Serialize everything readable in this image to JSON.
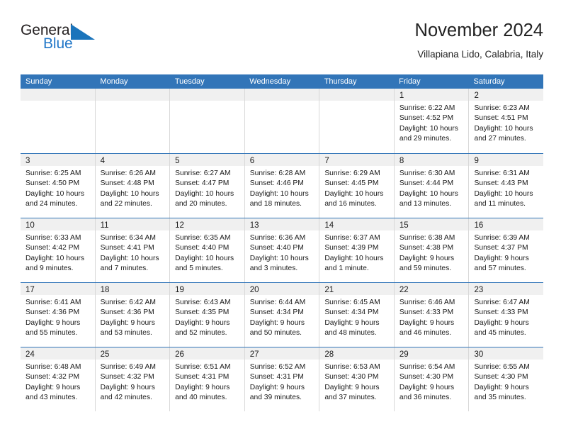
{
  "logo": {
    "word_top": "General",
    "word_bottom": "Blue",
    "triangle_icon": "blue-triangle-icon",
    "top_color": "#231f20",
    "bottom_color": "#2277c8"
  },
  "header": {
    "title": "November 2024",
    "subtitle": "Villapiana Lido, Calabria, Italy"
  },
  "theme": {
    "header_blue": "#3275b8",
    "daynum_strip": "#f0f0f0",
    "cell_border": "#d8d8d8",
    "text": "#1a1a1a"
  },
  "weekdays": [
    "Sunday",
    "Monday",
    "Tuesday",
    "Wednesday",
    "Thursday",
    "Friday",
    "Saturday"
  ],
  "weeks": [
    [
      {
        "day": ""
      },
      {
        "day": ""
      },
      {
        "day": ""
      },
      {
        "day": ""
      },
      {
        "day": ""
      },
      {
        "day": "1",
        "sunrise": "Sunrise: 6:22 AM",
        "sunset": "Sunset: 4:52 PM",
        "daylight_1": "Daylight: 10 hours",
        "daylight_2": "and 29 minutes."
      },
      {
        "day": "2",
        "sunrise": "Sunrise: 6:23 AM",
        "sunset": "Sunset: 4:51 PM",
        "daylight_1": "Daylight: 10 hours",
        "daylight_2": "and 27 minutes."
      }
    ],
    [
      {
        "day": "3",
        "sunrise": "Sunrise: 6:25 AM",
        "sunset": "Sunset: 4:50 PM",
        "daylight_1": "Daylight: 10 hours",
        "daylight_2": "and 24 minutes."
      },
      {
        "day": "4",
        "sunrise": "Sunrise: 6:26 AM",
        "sunset": "Sunset: 4:48 PM",
        "daylight_1": "Daylight: 10 hours",
        "daylight_2": "and 22 minutes."
      },
      {
        "day": "5",
        "sunrise": "Sunrise: 6:27 AM",
        "sunset": "Sunset: 4:47 PM",
        "daylight_1": "Daylight: 10 hours",
        "daylight_2": "and 20 minutes."
      },
      {
        "day": "6",
        "sunrise": "Sunrise: 6:28 AM",
        "sunset": "Sunset: 4:46 PM",
        "daylight_1": "Daylight: 10 hours",
        "daylight_2": "and 18 minutes."
      },
      {
        "day": "7",
        "sunrise": "Sunrise: 6:29 AM",
        "sunset": "Sunset: 4:45 PM",
        "daylight_1": "Daylight: 10 hours",
        "daylight_2": "and 16 minutes."
      },
      {
        "day": "8",
        "sunrise": "Sunrise: 6:30 AM",
        "sunset": "Sunset: 4:44 PM",
        "daylight_1": "Daylight: 10 hours",
        "daylight_2": "and 13 minutes."
      },
      {
        "day": "9",
        "sunrise": "Sunrise: 6:31 AM",
        "sunset": "Sunset: 4:43 PM",
        "daylight_1": "Daylight: 10 hours",
        "daylight_2": "and 11 minutes."
      }
    ],
    [
      {
        "day": "10",
        "sunrise": "Sunrise: 6:33 AM",
        "sunset": "Sunset: 4:42 PM",
        "daylight_1": "Daylight: 10 hours",
        "daylight_2": "and 9 minutes."
      },
      {
        "day": "11",
        "sunrise": "Sunrise: 6:34 AM",
        "sunset": "Sunset: 4:41 PM",
        "daylight_1": "Daylight: 10 hours",
        "daylight_2": "and 7 minutes."
      },
      {
        "day": "12",
        "sunrise": "Sunrise: 6:35 AM",
        "sunset": "Sunset: 4:40 PM",
        "daylight_1": "Daylight: 10 hours",
        "daylight_2": "and 5 minutes."
      },
      {
        "day": "13",
        "sunrise": "Sunrise: 6:36 AM",
        "sunset": "Sunset: 4:40 PM",
        "daylight_1": "Daylight: 10 hours",
        "daylight_2": "and 3 minutes."
      },
      {
        "day": "14",
        "sunrise": "Sunrise: 6:37 AM",
        "sunset": "Sunset: 4:39 PM",
        "daylight_1": "Daylight: 10 hours",
        "daylight_2": "and 1 minute."
      },
      {
        "day": "15",
        "sunrise": "Sunrise: 6:38 AM",
        "sunset": "Sunset: 4:38 PM",
        "daylight_1": "Daylight: 9 hours",
        "daylight_2": "and 59 minutes."
      },
      {
        "day": "16",
        "sunrise": "Sunrise: 6:39 AM",
        "sunset": "Sunset: 4:37 PM",
        "daylight_1": "Daylight: 9 hours",
        "daylight_2": "and 57 minutes."
      }
    ],
    [
      {
        "day": "17",
        "sunrise": "Sunrise: 6:41 AM",
        "sunset": "Sunset: 4:36 PM",
        "daylight_1": "Daylight: 9 hours",
        "daylight_2": "and 55 minutes."
      },
      {
        "day": "18",
        "sunrise": "Sunrise: 6:42 AM",
        "sunset": "Sunset: 4:36 PM",
        "daylight_1": "Daylight: 9 hours",
        "daylight_2": "and 53 minutes."
      },
      {
        "day": "19",
        "sunrise": "Sunrise: 6:43 AM",
        "sunset": "Sunset: 4:35 PM",
        "daylight_1": "Daylight: 9 hours",
        "daylight_2": "and 52 minutes."
      },
      {
        "day": "20",
        "sunrise": "Sunrise: 6:44 AM",
        "sunset": "Sunset: 4:34 PM",
        "daylight_1": "Daylight: 9 hours",
        "daylight_2": "and 50 minutes."
      },
      {
        "day": "21",
        "sunrise": "Sunrise: 6:45 AM",
        "sunset": "Sunset: 4:34 PM",
        "daylight_1": "Daylight: 9 hours",
        "daylight_2": "and 48 minutes."
      },
      {
        "day": "22",
        "sunrise": "Sunrise: 6:46 AM",
        "sunset": "Sunset: 4:33 PM",
        "daylight_1": "Daylight: 9 hours",
        "daylight_2": "and 46 minutes."
      },
      {
        "day": "23",
        "sunrise": "Sunrise: 6:47 AM",
        "sunset": "Sunset: 4:33 PM",
        "daylight_1": "Daylight: 9 hours",
        "daylight_2": "and 45 minutes."
      }
    ],
    [
      {
        "day": "24",
        "sunrise": "Sunrise: 6:48 AM",
        "sunset": "Sunset: 4:32 PM",
        "daylight_1": "Daylight: 9 hours",
        "daylight_2": "and 43 minutes."
      },
      {
        "day": "25",
        "sunrise": "Sunrise: 6:49 AM",
        "sunset": "Sunset: 4:32 PM",
        "daylight_1": "Daylight: 9 hours",
        "daylight_2": "and 42 minutes."
      },
      {
        "day": "26",
        "sunrise": "Sunrise: 6:51 AM",
        "sunset": "Sunset: 4:31 PM",
        "daylight_1": "Daylight: 9 hours",
        "daylight_2": "and 40 minutes."
      },
      {
        "day": "27",
        "sunrise": "Sunrise: 6:52 AM",
        "sunset": "Sunset: 4:31 PM",
        "daylight_1": "Daylight: 9 hours",
        "daylight_2": "and 39 minutes."
      },
      {
        "day": "28",
        "sunrise": "Sunrise: 6:53 AM",
        "sunset": "Sunset: 4:30 PM",
        "daylight_1": "Daylight: 9 hours",
        "daylight_2": "and 37 minutes."
      },
      {
        "day": "29",
        "sunrise": "Sunrise: 6:54 AM",
        "sunset": "Sunset: 4:30 PM",
        "daylight_1": "Daylight: 9 hours",
        "daylight_2": "and 36 minutes."
      },
      {
        "day": "30",
        "sunrise": "Sunrise: 6:55 AM",
        "sunset": "Sunset: 4:30 PM",
        "daylight_1": "Daylight: 9 hours",
        "daylight_2": "and 35 minutes."
      }
    ]
  ]
}
